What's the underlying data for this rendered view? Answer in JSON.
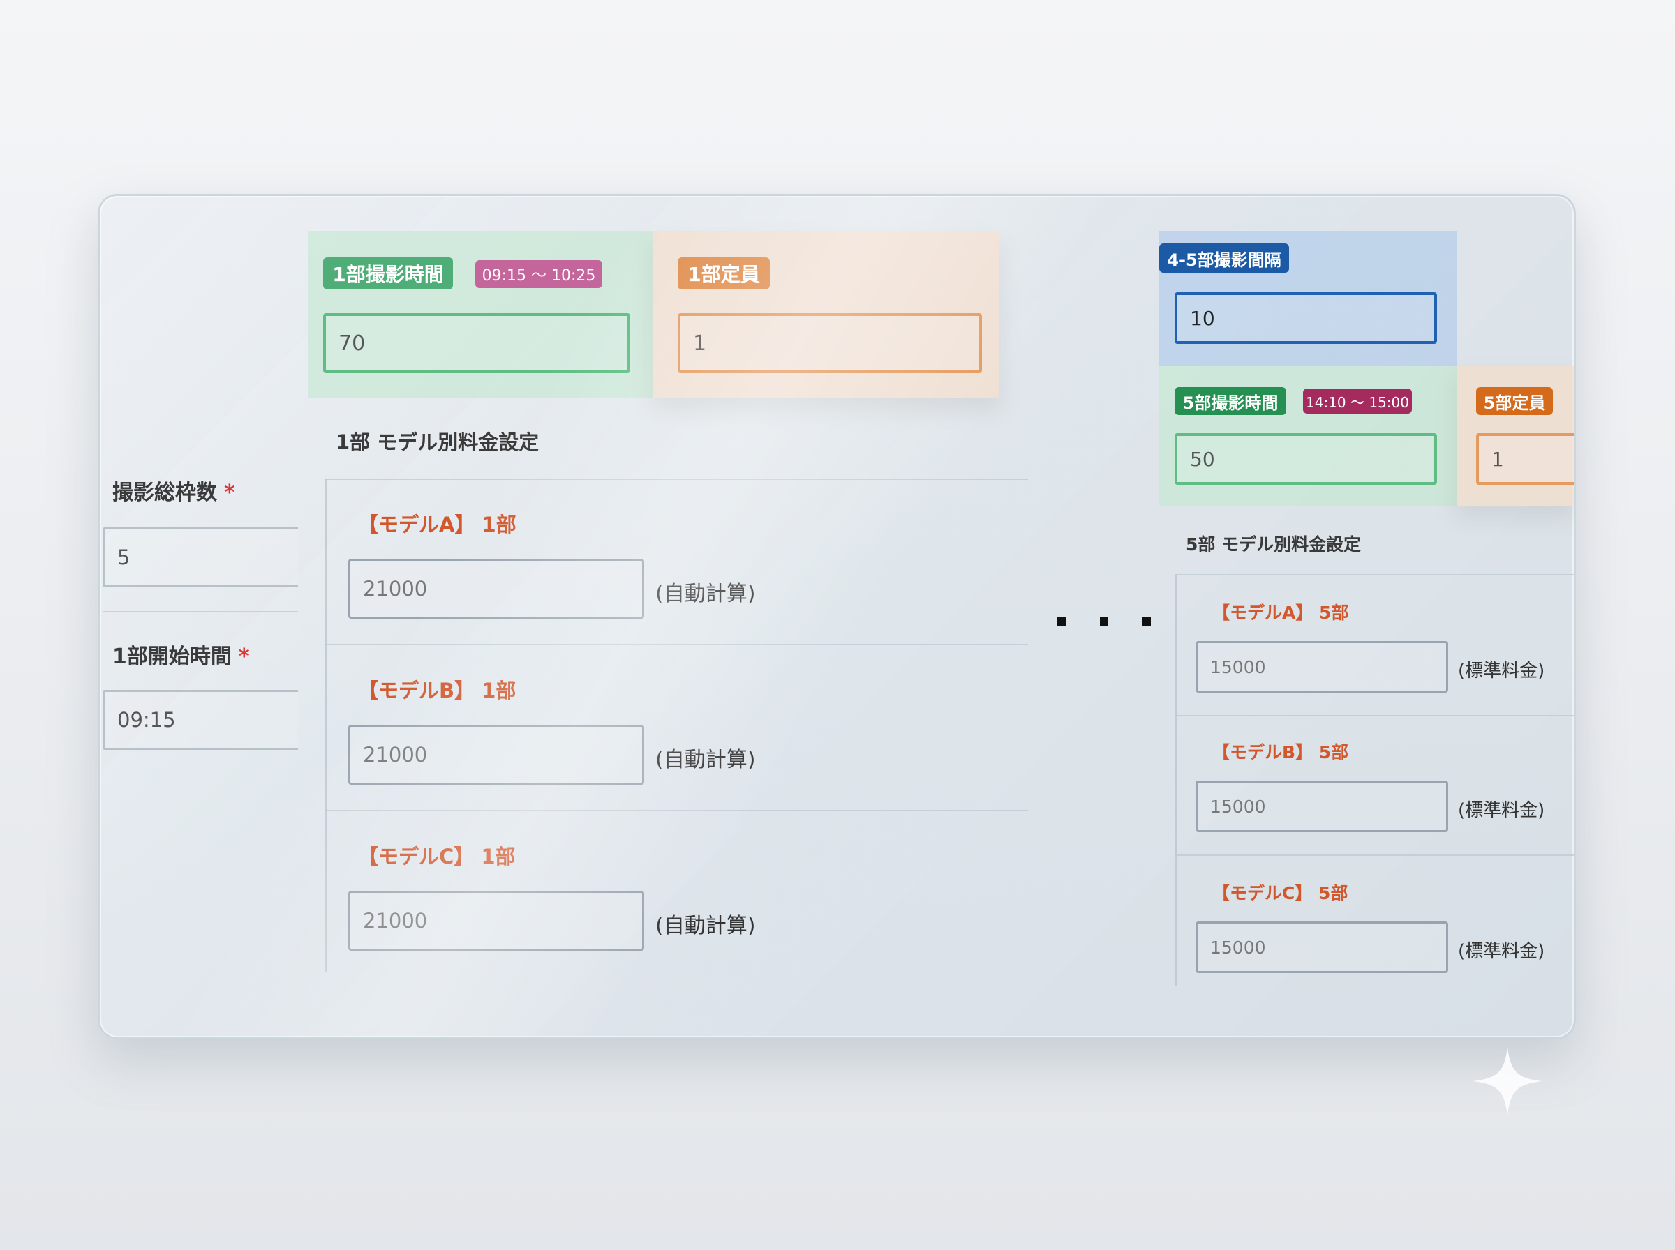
{
  "left": {
    "total_slots_label": "撮影総枠数",
    "total_slots_required": "*",
    "total_slots_value": "5",
    "start_time_label": "1部開始時間",
    "start_time_required": "*",
    "start_time_value": "09:15"
  },
  "part1": {
    "duration_badge": "1部撮影時間",
    "time_range_badge": "09:15 ～ 10:25",
    "duration_value": "70",
    "capacity_badge": "1部定員",
    "capacity_value": "1",
    "pricing_title": "1部 モデル別料金設定",
    "models": [
      {
        "label": "【モデルA】 1部",
        "price": "21000",
        "note": "(自動計算)"
      },
      {
        "label": "【モデルB】 1部",
        "price": "21000",
        "note": "(自動計算)"
      },
      {
        "label": "【モデルC】 1部",
        "price": "21000",
        "note": "(自動計算)"
      }
    ]
  },
  "interval": {
    "badge": "4-5部撮影間隔",
    "value": "10"
  },
  "part5": {
    "duration_badge": "5部撮影時間",
    "time_range_badge": "14:10 ～ 15:00",
    "duration_value": "50",
    "capacity_badge": "5部定員",
    "capacity_value": "1",
    "pricing_title": "5部 モデル別料金設定",
    "models": [
      {
        "label": "【モデルA】 5部",
        "price": "15000",
        "note": "(標準料金)"
      },
      {
        "label": "【モデルB】 5部",
        "price": "15000",
        "note": "(標準料金)"
      },
      {
        "label": "【モデルC】 5部",
        "price": "15000",
        "note": "(標準料金)"
      }
    ]
  },
  "colors": {
    "green": "#4fae78",
    "orange": "#e08d4c",
    "blue": "#1d5aa6",
    "pink": "#c4669c",
    "model_label": "#d2572c"
  },
  "icons": {
    "ellipsis": "ellipsis-icon",
    "sparkle": "sparkle-icon"
  }
}
